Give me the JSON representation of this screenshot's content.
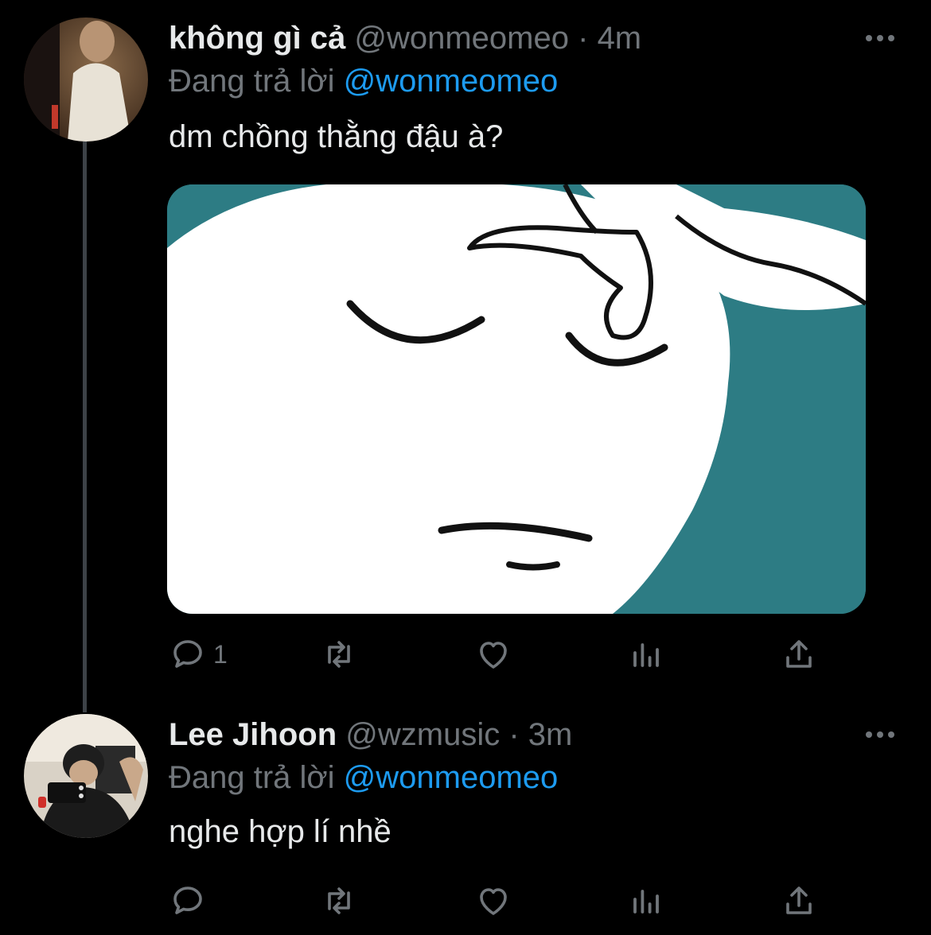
{
  "tweets": [
    {
      "name": "không gì cả",
      "handle": "@wonmeomeo",
      "separator": "·",
      "time": "4m",
      "reply_prefix": "Đang trả lời",
      "reply_to": "@wonmeomeo",
      "text": "dm chồng thằng đậu à?",
      "reply_count": "1",
      "has_media": true
    },
    {
      "name": "Lee Jihoon",
      "handle": "@wzmusic",
      "separator": "·",
      "time": "3m",
      "reply_prefix": "Đang trả lời",
      "reply_to": "@wonmeomeo",
      "text": "nghe hợp lí nhề",
      "reply_count": ""
    }
  ],
  "icons": [
    "reply-icon",
    "retweet-icon",
    "like-icon",
    "analytics-icon",
    "share-icon",
    "more-icon"
  ],
  "colors": {
    "background": "#000000",
    "text": "#e7e9ea",
    "muted": "#71767b",
    "link": "#1d9bf0",
    "media_bg": "#2d7c84"
  }
}
